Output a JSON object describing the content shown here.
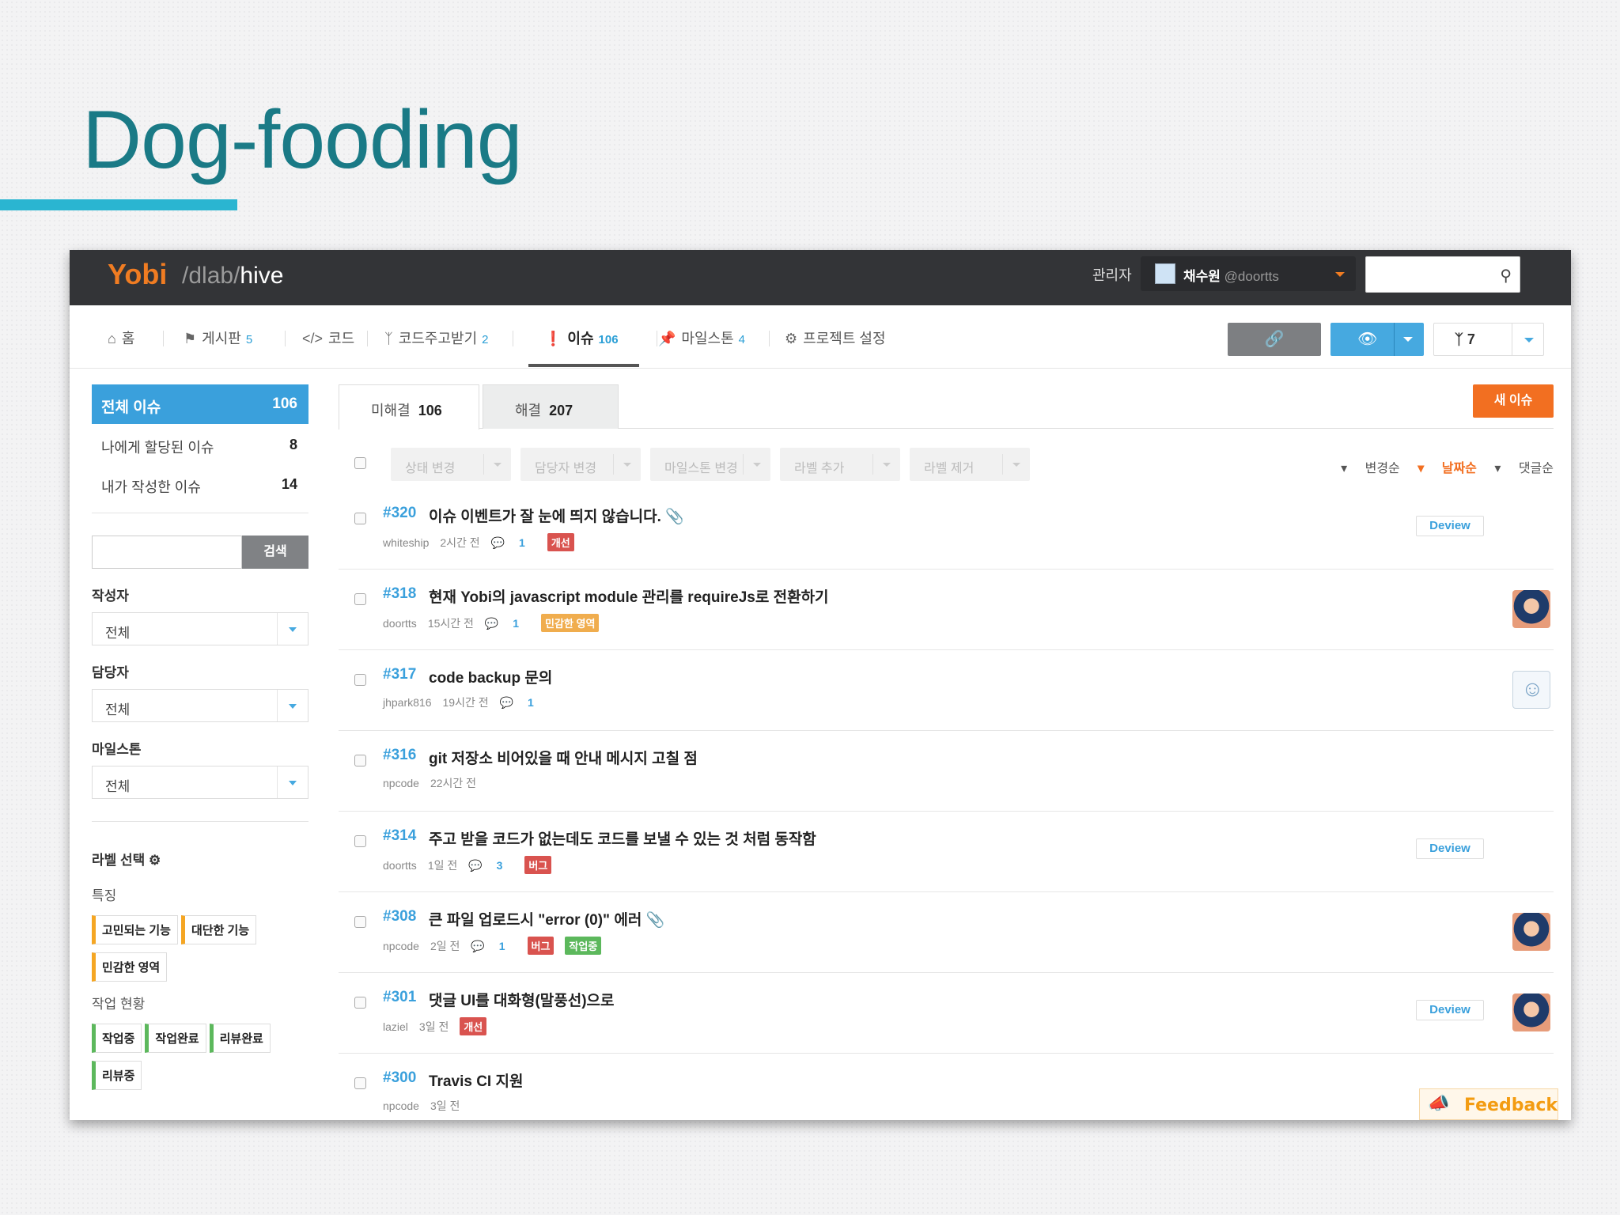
{
  "slide": {
    "title": "Dog-fooding"
  },
  "topbar": {
    "logo": "Yobi",
    "crumb_sep1": "/",
    "crumb_org": "dlab",
    "crumb_sep2": "/",
    "crumb_project": "hive",
    "admin_label": "관리자",
    "user_name": "채수원",
    "user_handle": "@doortts",
    "search_icon": "search-icon"
  },
  "nav": {
    "items": [
      {
        "label": "홈",
        "count": "",
        "icon": "home-icon"
      },
      {
        "label": "게시판",
        "count": "5",
        "icon": "megaphone-icon"
      },
      {
        "label": "코드",
        "count": "",
        "icon": "code-icon"
      },
      {
        "label": "코드주고받기",
        "count": "2",
        "icon": "pullrequest-icon"
      },
      {
        "label": "이슈",
        "count": "106",
        "icon": "exclamation-icon"
      },
      {
        "label": "마일스톤",
        "count": "4",
        "icon": "pin-icon"
      },
      {
        "label": "프로젝트 설정",
        "count": "",
        "icon": "gears-icon"
      }
    ],
    "fork_count": "7"
  },
  "sidebar": {
    "all": {
      "label": "전체 이슈",
      "count": "106"
    },
    "assigned": {
      "label": "나에게 할당된 이슈",
      "count": "8"
    },
    "mine": {
      "label": "내가 작성한 이슈",
      "count": "14"
    },
    "search_button": "검색",
    "author_label": "작성자",
    "author_value": "전체",
    "assignee_label": "담당자",
    "assignee_value": "전체",
    "milestone_label": "마일스톤",
    "milestone_value": "전체",
    "label_select": "라벨 선택",
    "group1": "특징",
    "group1_labels": [
      "고민되는 기능",
      "대단한 기능",
      "민감한 영역"
    ],
    "group2": "작업 현황",
    "group2_labels": [
      "작업중",
      "작업완료",
      "리뷰완료",
      "리뷰중"
    ]
  },
  "main": {
    "tab_open": "미해결",
    "tab_open_count": "106",
    "tab_closed": "해결",
    "tab_closed_count": "207",
    "new_issue": "새 이슈",
    "bulk": [
      "상태 변경",
      "담당자 변경",
      "마일스톤 변경",
      "라벨 추가",
      "라벨 제거"
    ],
    "sort_updated": "변경순",
    "sort_date": "날짜순",
    "sort_comments": "댓글순",
    "issues": [
      {
        "num": "#320",
        "title": "이슈 이벤트가 잘 눈에 띄지 않습니다.",
        "author": "whiteship",
        "time": "2시간 전",
        "comments": "1",
        "labels": [
          "개선"
        ],
        "deview": "Deview",
        "attach": true
      },
      {
        "num": "#318",
        "title": "현재 Yobi의 javascript module 관리를 requireJs로 전환하기",
        "author": "doortts",
        "time": "15시간 전",
        "comments": "1",
        "labels": [
          "민감한 영역"
        ]
      },
      {
        "num": "#317",
        "title": "code backup 문의",
        "author": "jhpark816",
        "time": "19시간 전",
        "comments": "1",
        "labels": []
      },
      {
        "num": "#316",
        "title": "git 저장소 비어있을 때 안내 메시지 고칠 점",
        "author": "npcode",
        "time": "22시간 전",
        "comments": "",
        "labels": []
      },
      {
        "num": "#314",
        "title": "주고 받을 코드가 없는데도 코드를 보낼 수 있는 것 처럼 동작함",
        "author": "doortts",
        "time": "1일 전",
        "comments": "3",
        "labels": [
          "버그"
        ],
        "deview": "Deview"
      },
      {
        "num": "#308",
        "title": "큰 파일 업로드시 \"error (0)\" 에러",
        "author": "npcode",
        "time": "2일 전",
        "comments": "1",
        "labels": [
          "버그",
          "작업중"
        ],
        "attach": true
      },
      {
        "num": "#301",
        "title": "댓글 UI를 대화형(말풍선)으로",
        "author": "laziel",
        "time": "3일 전",
        "comments": "",
        "labels": [
          "개선"
        ],
        "deview": "Deview"
      },
      {
        "num": "#300",
        "title": "Travis CI 지원",
        "author": "npcode",
        "time": "3일 전",
        "comments": "",
        "labels": []
      }
    ],
    "feedback": "Feedback"
  },
  "colors": {
    "brand": "#f07c22",
    "accent": "#3aa0dc",
    "title": "#1a7a86",
    "new_issue": "#f26f21"
  }
}
